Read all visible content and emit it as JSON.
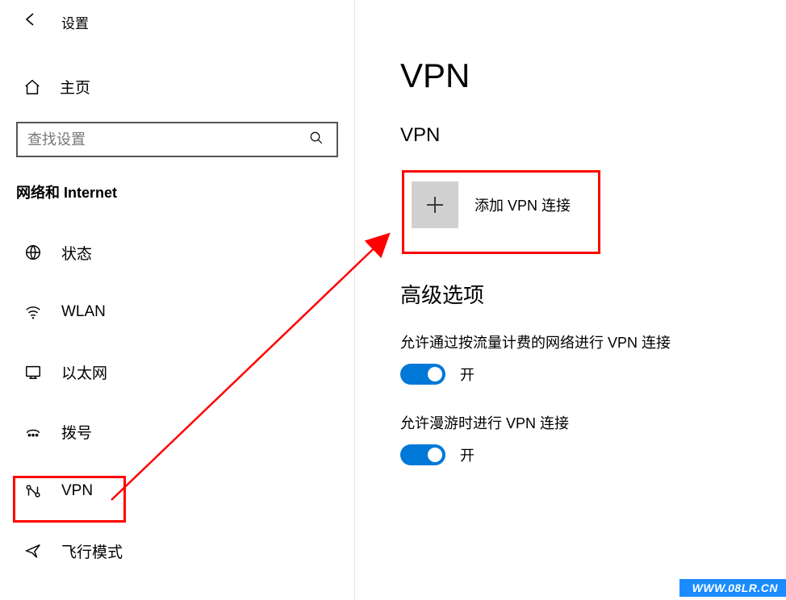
{
  "header": {
    "title": "设置"
  },
  "home": {
    "label": "主页"
  },
  "search": {
    "placeholder": "查找设置"
  },
  "section": {
    "label": "网络和 Internet"
  },
  "nav": {
    "status": "状态",
    "wlan": "WLAN",
    "ethernet": "以太网",
    "dialup": "拨号",
    "vpn": "VPN",
    "airplane": "飞行模式"
  },
  "page": {
    "title": "VPN",
    "vpn_subhead": "VPN",
    "add_vpn_label": "添加 VPN 连接",
    "advanced_title": "高级选项",
    "opt1_label": "允许通过按流量计费的网络进行 VPN 连接",
    "opt1_state": "开",
    "opt2_label": "允许漫游时进行 VPN 连接",
    "opt2_state": "开"
  },
  "watermark": "WWW.08LR.CN"
}
